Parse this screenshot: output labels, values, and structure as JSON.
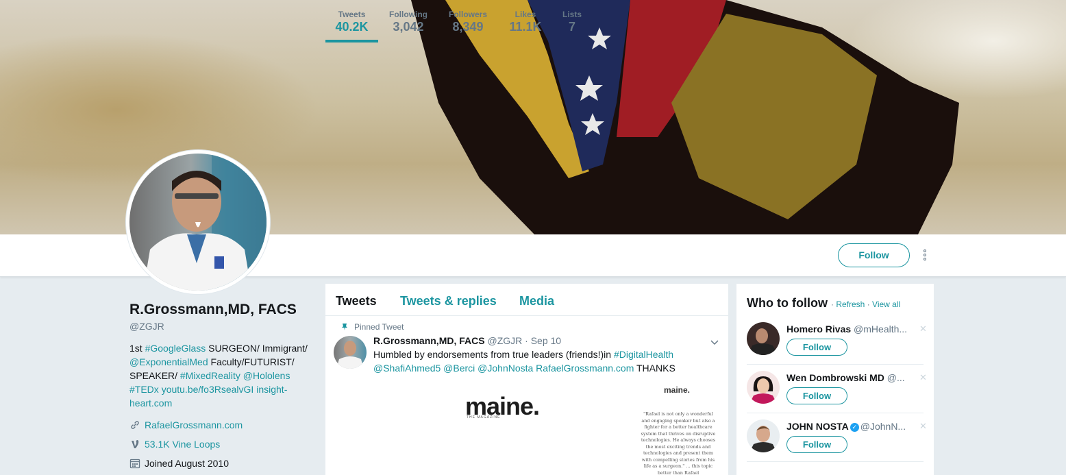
{
  "profile": {
    "name": "R.Grossmann,MD, FACS",
    "handle": "@ZGJR",
    "bio": {
      "p1": "1st ",
      "tag1": "#GoogleGlass",
      "p2": " SURGEON/ Immigrant/ ",
      "mention1": "@ExponentialMed",
      "p3": " Faculty/FUTURIST/ SPEAKER/ ",
      "tag2": "#MixedReality",
      "p4": " ",
      "mention2": "@Hololens",
      "p5": " ",
      "tag3": "#TEDx",
      "p6": " ",
      "link1": "youtu.be/fo3RsealvGI",
      "p7": " ",
      "link2": "insight-heart.com"
    },
    "website": "RafaelGrossmann.com",
    "vine_loops": "53.1K Vine Loops",
    "joined": "Joined August 2010"
  },
  "stats": [
    {
      "label": "Tweets",
      "value": "40.2K"
    },
    {
      "label": "Following",
      "value": "3,042"
    },
    {
      "label": "Followers",
      "value": "8,349"
    },
    {
      "label": "Likes",
      "value": "11.1K"
    },
    {
      "label": "Lists",
      "value": "7"
    }
  ],
  "follow_label": "Follow",
  "timeline": {
    "tabs": [
      "Tweets",
      "Tweets & replies",
      "Media"
    ],
    "pinned_label": "Pinned Tweet",
    "tweet": {
      "name": "R.Grossmann,MD, FACS",
      "handle_time": "@ZGJR · Sep 10",
      "text1": "Humbled by endorsements from true leaders (friends!)in ",
      "tag": "#DigitalHealth",
      "mentions": "@ShafiAhmed5 @Berci @JohnNosta RafaelGrossmann.com",
      "text2": " THANKS"
    },
    "media": {
      "logo": "maine.",
      "logo_sub": "THE MAGAZINE",
      "logo_small": "maine.",
      "quote": "\"Rafael is not only a wonderful and engaging speaker but also a fighter for a better healthcare system that thrives on disruptive technologies. He always chooses the most exciting trends and technologies and present them with compelling stories from his life as a surgeon.\" ... this topic better than Rafael"
    }
  },
  "who_to_follow": {
    "title": "Who to follow",
    "refresh": "Refresh",
    "view_all": "View all",
    "sep": " · ",
    "suggestions": [
      {
        "name": "Homero Rivas",
        "handle": "@mHealth...",
        "button": "Follow"
      },
      {
        "name": "Wen Dombrowski MD",
        "handle": "@...",
        "button": "Follow"
      },
      {
        "name": "JOHN NOSTA",
        "handle": "@JohnN...",
        "button": "Follow",
        "verified": true
      }
    ]
  },
  "colors": {
    "accent": "#1b95a0",
    "muted": "#657786",
    "background": "#e6ecf0"
  }
}
